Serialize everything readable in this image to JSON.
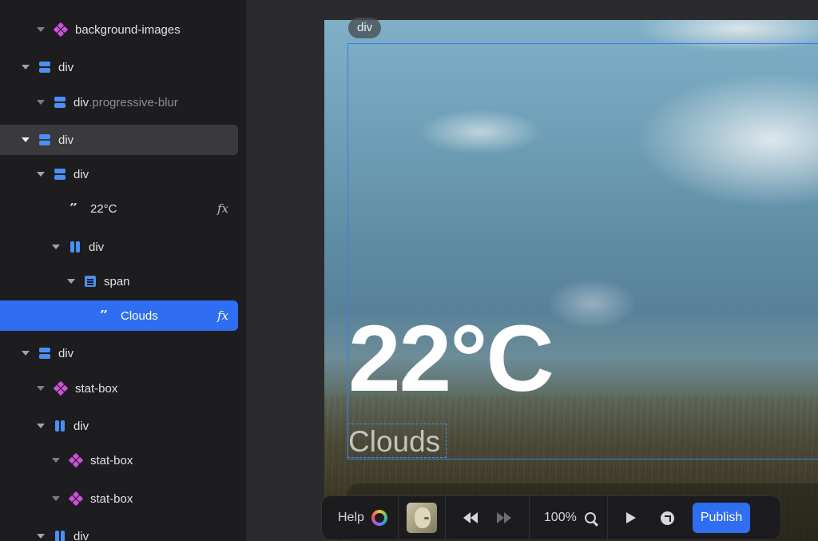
{
  "layers": [
    {
      "indent": 1,
      "caret": "light",
      "icon": "component",
      "label": "background-images",
      "cls": "",
      "fx": false,
      "state": ""
    },
    {
      "indent": 0,
      "caret": "normal",
      "icon": "stack",
      "label": "div",
      "cls": "",
      "fx": false,
      "state": ""
    },
    {
      "indent": 1,
      "caret": "light",
      "icon": "stack",
      "label": "div",
      "cls": ".progressive-blur",
      "fx": false,
      "state": ""
    },
    {
      "indent": 0,
      "caret": "normal",
      "icon": "stack",
      "label": "div",
      "cls": "",
      "fx": false,
      "state": "hover"
    },
    {
      "indent": 1,
      "caret": "normal",
      "icon": "stack",
      "label": "div",
      "cls": "",
      "fx": false,
      "state": ""
    },
    {
      "indent": 2,
      "caret": "none",
      "icon": "quote",
      "label": "22°C",
      "cls": "",
      "fx": true,
      "state": ""
    },
    {
      "indent": 2,
      "caret": "normal",
      "icon": "cols",
      "label": "div",
      "cls": "",
      "fx": false,
      "state": ""
    },
    {
      "indent": 3,
      "caret": "normal",
      "icon": "text",
      "label": "span",
      "cls": "",
      "fx": false,
      "state": ""
    },
    {
      "indent": 4,
      "caret": "none",
      "icon": "quote",
      "label": "Clouds",
      "cls": "",
      "fx": true,
      "state": "selected"
    },
    {
      "indent": 0,
      "caret": "normal",
      "icon": "stack",
      "label": "div",
      "cls": "",
      "fx": false,
      "state": ""
    },
    {
      "indent": 1,
      "caret": "light",
      "icon": "component",
      "label": "stat-box",
      "cls": "",
      "fx": false,
      "state": ""
    },
    {
      "indent": 1,
      "caret": "normal",
      "icon": "cols",
      "label": "div",
      "cls": "",
      "fx": false,
      "state": ""
    },
    {
      "indent": 2,
      "caret": "light",
      "icon": "component",
      "label": "stat-box",
      "cls": "",
      "fx": false,
      "state": ""
    },
    {
      "indent": 2,
      "caret": "light",
      "icon": "component",
      "label": "stat-box",
      "cls": "",
      "fx": false,
      "state": ""
    },
    {
      "indent": 1,
      "caret": "normal",
      "icon": "cols",
      "label": "div",
      "cls": "",
      "fx": false,
      "state": ""
    }
  ],
  "canvas": {
    "tag": "div",
    "temperature": "22°C",
    "condition": "Clouds"
  },
  "toolbar": {
    "help_label": "Help",
    "zoom_label": "100%",
    "publish_label": "Publish"
  },
  "colors": {
    "accent": "#2f6ef0",
    "component_icon": "#d14fe0",
    "element_icon": "#4b8ff5"
  },
  "fx_label": "fx"
}
